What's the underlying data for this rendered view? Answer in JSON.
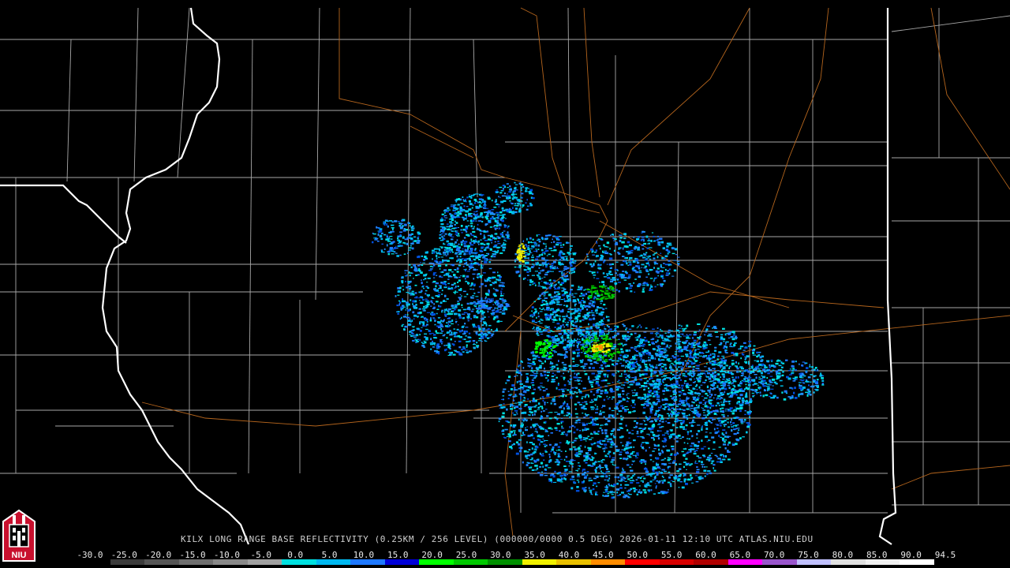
{
  "product_caption": "KILX LONG RANGE BASE REFLECTIVITY (0.25KM / 256 LEVEL) (000000/0000 0.5 DEG) 2026-01-11 12:10 UTC  ATLAS.NIU.EDU",
  "logo_text": "NIU",
  "scale": {
    "ticks": [
      "-30.0",
      "-25.0",
      "-20.0",
      "-15.0",
      "-10.0",
      "-5.0",
      "0.0",
      "5.0",
      "10.0",
      "15.0",
      "20.0",
      "25.0",
      "30.0",
      "35.0",
      "40.0",
      "45.0",
      "50.0",
      "55.0",
      "60.0",
      "65.0",
      "70.0",
      "75.0",
      "80.0",
      "85.0",
      "90.0",
      "94.5"
    ],
    "colors": [
      "#000000",
      "#3b3b3b",
      "#555555",
      "#6e6e6e",
      "#888888",
      "#a0a0a0",
      "#00e0e0",
      "#00b8f0",
      "#1e78ff",
      "#0000d8",
      "#00ff00",
      "#00c800",
      "#009000",
      "#f0f000",
      "#e8c000",
      "#ff8c00",
      "#ff0000",
      "#d80000",
      "#b00000",
      "#ff00ff",
      "#9955cc",
      "#c0c0ff",
      "#e0e0e0",
      "#f0f0f0",
      "#ffffff"
    ]
  },
  "colors": {
    "state_border": "#ffffff",
    "county_border": "#a8a8a8",
    "highway": "#b5651d",
    "background": "#000000"
  }
}
